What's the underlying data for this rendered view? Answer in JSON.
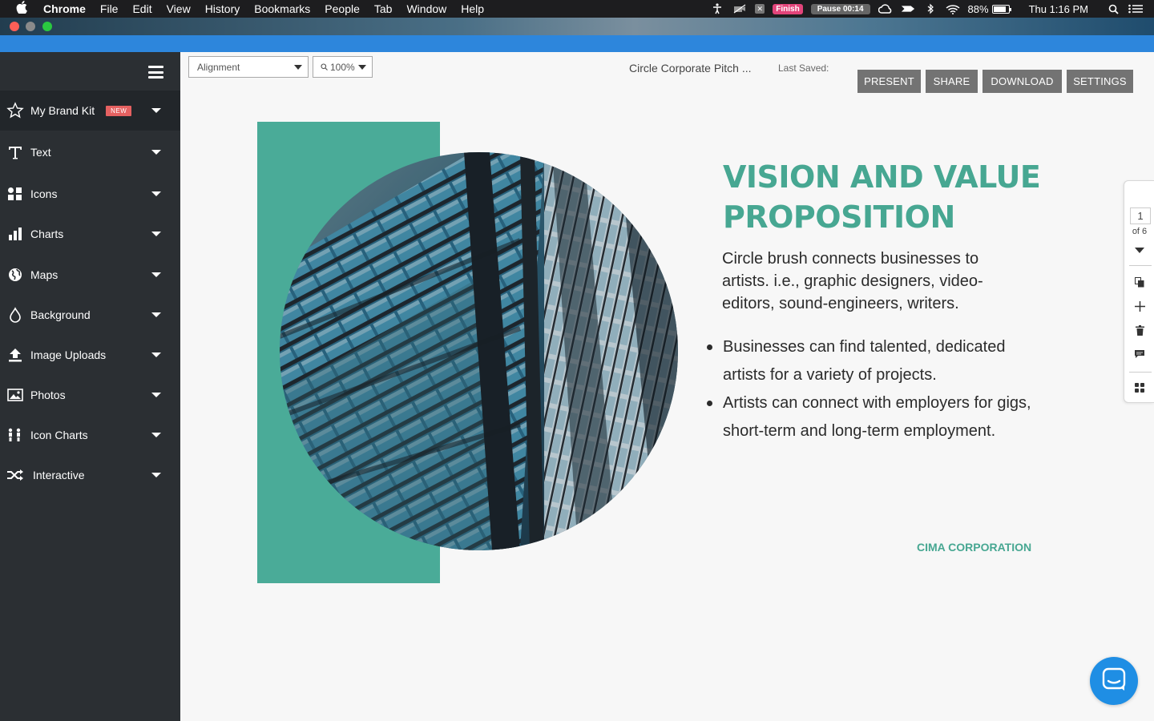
{
  "menubar": {
    "app": "Chrome",
    "items": [
      "File",
      "Edit",
      "View",
      "History",
      "Bookmarks",
      "People",
      "Tab",
      "Window",
      "Help"
    ],
    "finish_label": "Finish",
    "pause_label": "Pause 00:14",
    "battery_percent": "88%",
    "battery_level": 0.88,
    "clock": "Thu 1:16 PM"
  },
  "sidebar": {
    "items": [
      {
        "label": "My Brand Kit",
        "icon": "star-icon",
        "badge": "NEW"
      },
      {
        "label": "Text",
        "icon": "text-icon"
      },
      {
        "label": "Icons",
        "icon": "icons-grid-icon"
      },
      {
        "label": "Charts",
        "icon": "bar-chart-icon"
      },
      {
        "label": "Maps",
        "icon": "globe-icon"
      },
      {
        "label": "Background",
        "icon": "paint-drop-icon"
      },
      {
        "label": "Image Uploads",
        "icon": "upload-icon"
      },
      {
        "label": "Photos",
        "icon": "photo-icon"
      },
      {
        "label": "Icon Charts",
        "icon": "people-chart-icon"
      },
      {
        "label": "Interactive",
        "icon": "shuffle-icon"
      }
    ]
  },
  "toolbar": {
    "alignment_value": "Alignment",
    "zoom_value": "100%",
    "doc_title": "Circle Corporate Pitch ...",
    "last_saved_label": "Last Saved:",
    "buttons": {
      "present": "PRESENT",
      "share": "SHARE",
      "download": "DOWNLOAD",
      "settings": "SETTINGS"
    }
  },
  "slide": {
    "title_line1": "VISION AND VALUE",
    "title_line2": "PROPOSITION",
    "intro": "Circle brush connects businesses to artists. i.e., graphic designers, video-editors, sound-engineers, writers.",
    "bullets": [
      "Businesses can find talented, dedicated artists for a variety of projects.",
      "Artists can connect with employers for gigs, short-term and long-term employment."
    ],
    "company": "CIMA CORPORATION"
  },
  "pager": {
    "current": "1",
    "total_label": "of 6"
  },
  "colors": {
    "accent_teal": "#47a792",
    "sidebar_bg": "#2b2f33",
    "button_gray": "#737373",
    "chrome_blue": "#2d86dc",
    "chat_blue": "#1f8ee4"
  }
}
